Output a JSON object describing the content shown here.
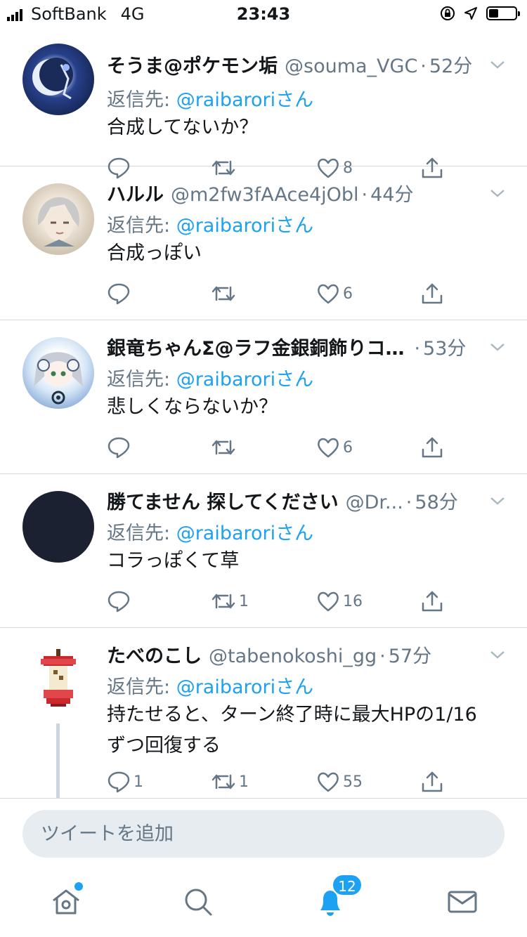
{
  "status_bar": {
    "carrier": "SoftBank",
    "network": "4G",
    "time": "23:43",
    "battery_level": 0.35
  },
  "tweets": [
    {
      "display_name": "そうま@ポケモン垢",
      "handle": "@souma_VGC",
      "separator": "·",
      "time": "52分",
      "reply_label": "返信先: ",
      "reply_mention": "@raibaroriさん",
      "text": "合成してないか？",
      "replies": "",
      "retweets": "",
      "likes": "8"
    },
    {
      "display_name": "ハルル",
      "handle": "@m2fw3fAAce4jObl",
      "separator": "·",
      "time": "44分",
      "reply_label": "返信先: ",
      "reply_mention": "@raibaroriさん",
      "text": "合成っぽい",
      "replies": "",
      "retweets": "",
      "likes": "6"
    },
    {
      "display_name": "銀竜ちゃんΣ@ラフ金銀銅飾りコ…",
      "handle": "",
      "separator": "·",
      "time": "53分",
      "reply_label": "返信先: ",
      "reply_mention": "@raibaroriさん",
      "text": "悲しくならないか？",
      "replies": "",
      "retweets": "",
      "likes": "6"
    },
    {
      "display_name": "勝てません 探してください",
      "handle": "@Dr...",
      "separator": "·",
      "time": "58分",
      "reply_label": "返信先: ",
      "reply_mention": "@raibaroriさん",
      "text": "コラっぽくて草",
      "replies": "",
      "retweets": "1",
      "likes": "16"
    },
    {
      "display_name": "たべのこし",
      "handle": "@tabenokoshi_gg",
      "separator": "·",
      "time": "57分",
      "reply_label": "返信先: ",
      "reply_mention": "@raibaroriさん",
      "text": "持たせると、ターン終了時に最大HPの1/16ずつ回復する",
      "replies": "1",
      "retweets": "1",
      "likes": "55"
    }
  ],
  "compose": {
    "placeholder": "ツイートを追加"
  },
  "tab_bar": {
    "notification_count": "12"
  },
  "colors": {
    "accent": "#1da1f2",
    "secondary_text": "#657786",
    "divider": "#d4d8dc"
  }
}
